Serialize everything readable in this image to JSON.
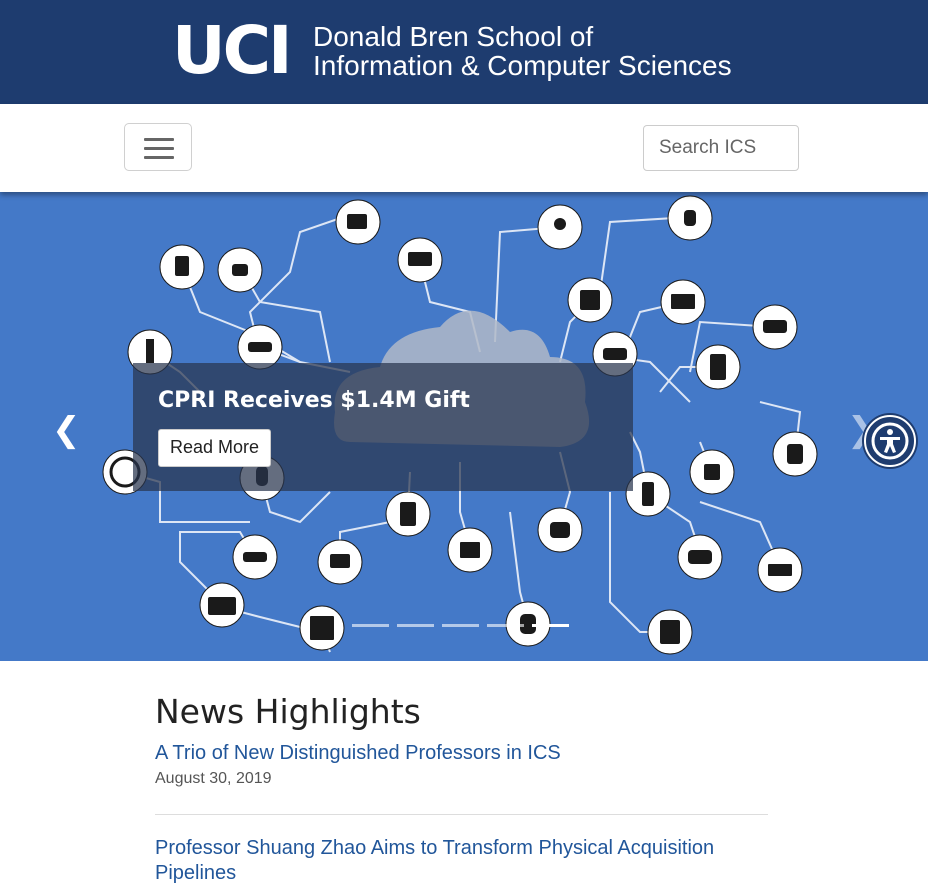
{
  "header": {
    "logo_text": "UCI",
    "school_line1": "Donald Bren School of",
    "school_line2": "Information & Computer Sciences"
  },
  "navbar": {
    "search_placeholder": "Search ICS"
  },
  "carousel": {
    "caption_title": "CPRI Receives $1.4M Gift",
    "read_more_label": "Read More",
    "prev_glyph": "❮",
    "next_glyph": "❯",
    "slide_count": 5,
    "active_slide": 5,
    "background_color": "#4479c8"
  },
  "news": {
    "heading": "News Highlights",
    "items": [
      {
        "title": "A Trio of New Distinguished Professors in ICS",
        "date": "August 30, 2019"
      },
      {
        "title": "Professor Shuang Zhao Aims to Transform Physical Acquisition Pipelines",
        "date": ""
      }
    ]
  },
  "colors": {
    "brand_navy": "#1e3c6f",
    "link_blue": "#21569a"
  },
  "icons": [
    "hamburger-menu-icon",
    "accessibility-icon",
    "iot-network-illustration"
  ]
}
